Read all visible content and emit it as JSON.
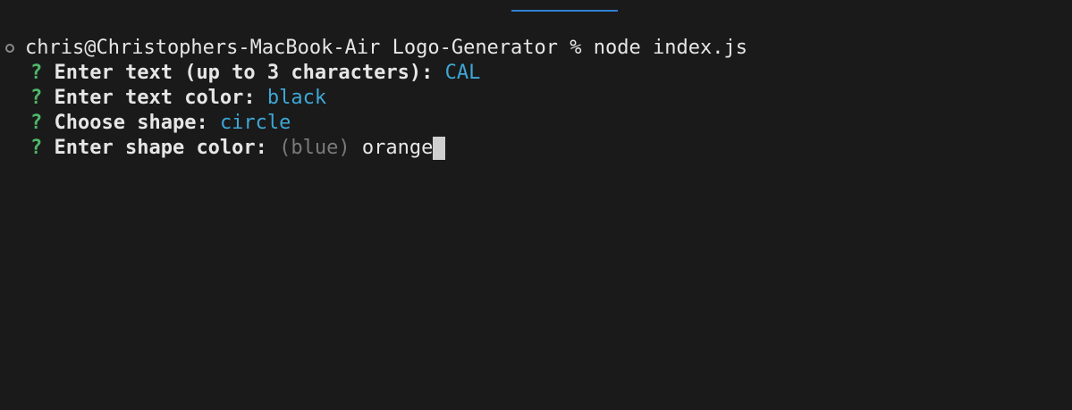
{
  "terminal": {
    "command_line": "chris@Christophers-MacBook-Air Logo-Generator % node index.js",
    "prompts": [
      {
        "qmark": "?",
        "question": "Enter text (up to 3 characters):",
        "answer": "CAL"
      },
      {
        "qmark": "?",
        "question": "Enter text color:",
        "answer": "black"
      },
      {
        "qmark": "?",
        "question": "Choose shape:",
        "answer": "circle"
      }
    ],
    "active_prompt": {
      "qmark": "?",
      "question": "Enter shape color:",
      "default": "(blue)",
      "typed": "orange"
    }
  },
  "colors": {
    "background": "#1a1a1a",
    "qmark": "#4fb86a",
    "answer": "#3ea7d6",
    "default_hint": "#7a7a7a",
    "tab_indicator": "#2f7fd1"
  }
}
